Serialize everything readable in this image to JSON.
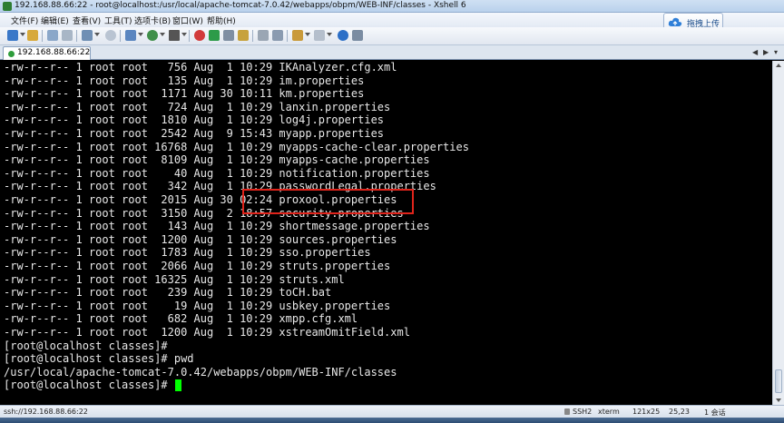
{
  "window": {
    "title": "192.168.88.66:22 - root@localhost:/usr/local/apache-tomcat-7.0.42/webapps/obpm/WEB-INF/classes - Xshell 6"
  },
  "menu": [
    {
      "label": "文件(F)"
    },
    {
      "label": "编辑(E)"
    },
    {
      "label": "查看(V)"
    },
    {
      "label": "工具(T)"
    },
    {
      "label": "选项卡(B)"
    },
    {
      "label": "窗口(W)"
    },
    {
      "label": "帮助(H)"
    }
  ],
  "upload_button": {
    "label": "拖拽上传"
  },
  "tab": {
    "label": "192.168.88.66:22"
  },
  "terminal": {
    "lines": [
      "-rw-r--r-- 1 root root   756 Aug  1 10:29 IKAnalyzer.cfg.xml",
      "-rw-r--r-- 1 root root   135 Aug  1 10:29 im.properties",
      "-rw-r--r-- 1 root root  1171 Aug 30 10:11 km.properties",
      "-rw-r--r-- 1 root root   724 Aug  1 10:29 lanxin.properties",
      "-rw-r--r-- 1 root root  1810 Aug  1 10:29 log4j.properties",
      "-rw-r--r-- 1 root root  2542 Aug  9 15:43 myapp.properties",
      "-rw-r--r-- 1 root root 16768 Aug  1 10:29 myapps-cache-clear.properties",
      "-rw-r--r-- 1 root root  8109 Aug  1 10:29 myapps-cache.properties",
      "-rw-r--r-- 1 root root    40 Aug  1 10:29 notification.properties",
      "-rw-r--r-- 1 root root   342 Aug  1 10:29 passwordLegal.properties",
      "-rw-r--r-- 1 root root  2015 Aug 30 02:24 proxool.properties",
      "-rw-r--r-- 1 root root  3150 Aug  2 18:57 security.properties",
      "-rw-r--r-- 1 root root   143 Aug  1 10:29 shortmessage.properties",
      "-rw-r--r-- 1 root root  1200 Aug  1 10:29 sources.properties",
      "-rw-r--r-- 1 root root  1783 Aug  1 10:29 sso.properties",
      "-rw-r--r-- 1 root root  2066 Aug  1 10:29 struts.properties",
      "-rw-r--r-- 1 root root 16325 Aug  1 10:29 struts.xml",
      "-rw-r--r-- 1 root root   239 Aug  1 10:29 toCH.bat",
      "-rw-r--r-- 1 root root    19 Aug  1 10:29 usbkey.properties",
      "-rw-r--r-- 1 root root   682 Aug  1 10:29 xmpp.cfg.xml",
      "-rw-r--r-- 1 root root  1200 Aug  1 10:29 xstreamOmitField.xml",
      "[root@localhost classes]#",
      "[root@localhost classes]# pwd",
      "/usr/local/apache-tomcat-7.0.42/webapps/obpm/WEB-INF/classes",
      "[root@localhost classes]# "
    ],
    "cursor_color": "#00ff00",
    "highlight_color": "#e0241b"
  },
  "status": {
    "host": "ssh://192.168.88.66:22",
    "protocol": "SSH2",
    "term": "xterm",
    "size": "121x25",
    "pos": "25,23",
    "sessions": "1 会话"
  }
}
